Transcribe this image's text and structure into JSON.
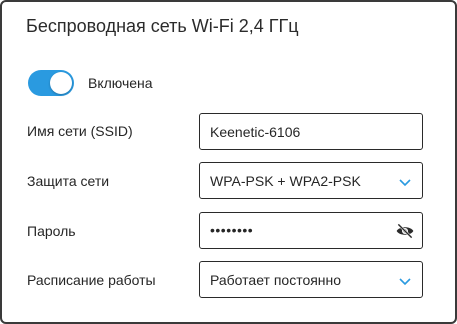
{
  "panel": {
    "title": "Беспроводная сеть Wi-Fi 2,4 ГГц"
  },
  "toggle": {
    "label": "Включена",
    "state": "on",
    "accent_color": "#2a9ae0"
  },
  "fields": {
    "ssid": {
      "label": "Имя сети (SSID)",
      "value": "Keenetic-6106"
    },
    "security": {
      "label": "Защита сети",
      "selected": "WPA-PSK + WPA2-PSK",
      "icon": "chevron-down-icon"
    },
    "password": {
      "label": "Пароль",
      "masked_value": "••••••••",
      "icon": "eye-slash-icon"
    },
    "schedule": {
      "label": "Расписание работы",
      "selected": "Работает постоянно",
      "icon": "chevron-down-icon"
    }
  }
}
